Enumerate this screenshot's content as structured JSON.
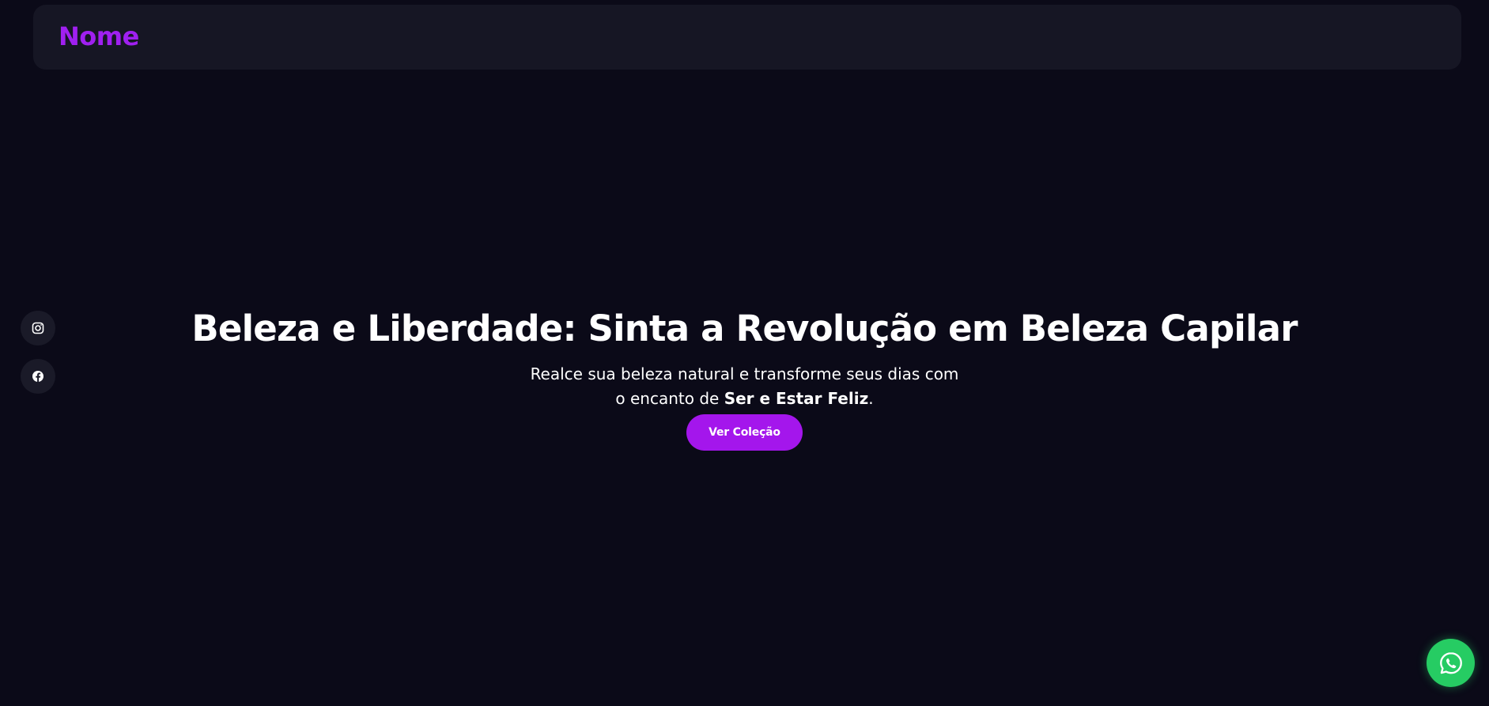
{
  "header": {
    "brand": "Nome"
  },
  "social": {
    "items": [
      {
        "icon": "instagram-icon"
      },
      {
        "icon": "facebook-icon"
      }
    ]
  },
  "hero": {
    "title": "Beleza e Liberdade: Sinta a Revolução em Beleza Capilar",
    "subtitle_prefix": "Realce sua beleza natural e transforme seus dias com o encanto de ",
    "subtitle_highlight": "Ser e Estar Feliz",
    "subtitle_suffix": ".",
    "cta_label": "Ver Coleção"
  },
  "floating": {
    "whatsapp_icon": "whatsapp-icon"
  },
  "colors": {
    "background": "#0b0a18",
    "navbar": "#161624",
    "accent": "#a416ec",
    "brand": "#a020f0",
    "whatsapp": "#26cc63"
  }
}
